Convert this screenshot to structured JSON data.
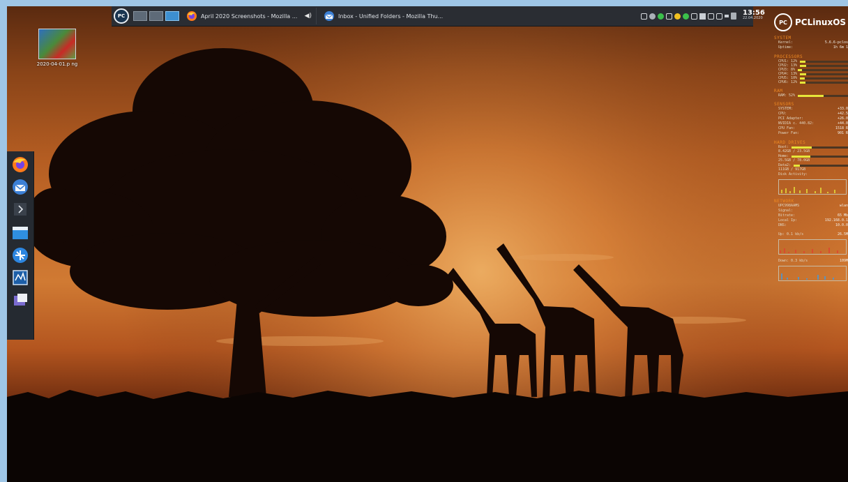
{
  "panel": {
    "menu_logo": "PC",
    "virtual_desktops": [
      {
        "active": false
      },
      {
        "active": false
      },
      {
        "active": true
      }
    ],
    "tasks": [
      {
        "title": "April 2020 Screenshots - Mozilla ...",
        "icon": "firefox-icon",
        "sound": "◀)"
      },
      {
        "title": "Inbox - Unified Folders - Mozilla Thu...",
        "icon": "thunderbird-icon"
      }
    ],
    "clock": {
      "time": "13:56",
      "date": "22.04.2020"
    }
  },
  "desktop_icon": {
    "label": "2020-04-01.p ng"
  },
  "dock": {
    "items": [
      "firefox-icon",
      "thunderbird-icon",
      "expand-arrow-icon",
      "files-icon",
      "network-icon",
      "system-monitor-icon",
      "messenger-icon"
    ]
  },
  "conky": {
    "brand": "PCLinuxOS",
    "system": {
      "header": "SYSTEM",
      "kernel_label": "Kernel:",
      "kernel": "5.6.6-pclos",
      "uptime_label": "Uptime:",
      "uptime": "1h 6m 1"
    },
    "processors": {
      "header": "PROCESSORS",
      "cpus": [
        {
          "label": "CPU1: 12%",
          "value": 12
        },
        {
          "label": "CPU2: 13%",
          "value": 13
        },
        {
          "label": "CPU3: 8%",
          "value": 8
        },
        {
          "label": "CPU4: 13%",
          "value": 13
        },
        {
          "label": "CPU5: 10%",
          "value": 10
        },
        {
          "label": "CPU6: 12%",
          "value": 12
        }
      ]
    },
    "ram": {
      "header": "RAM",
      "label": "RAM:  52%",
      "value": 52
    },
    "sensors": {
      "header": "SENSORS",
      "rows": [
        {
          "label": "SYSTEM:",
          "value": "+33.0"
        },
        {
          "label": "CPU:",
          "value": "+42.5"
        },
        {
          "label": "PCI Adapter:",
          "value": "+26.0"
        },
        {
          "label": "NVIDIA c. 440.82:",
          "value": "+44.0"
        },
        {
          "label": "CPU Fan:",
          "value": "1518 R"
        },
        {
          "label": "Power Fan:",
          "value": "901 R"
        }
      ]
    },
    "drives": {
      "header": "HARD DRIVES",
      "disks": [
        {
          "name": "Root:",
          "usage": "8.42GB / 23.5GB",
          "value": 36
        },
        {
          "name": "Home:",
          "usage": "25.5GB / 78.0GB",
          "value": 33
        },
        {
          "name": "Data2:",
          "usage": "111GB / 917GB",
          "value": 12
        }
      ],
      "activity_label": "Disk Activity:"
    },
    "network": {
      "header": "NETWORK",
      "rows": [
        {
          "label": "UPC998AAMS",
          "value": "wlan"
        },
        {
          "label": "Signal:",
          "value": ""
        },
        {
          "label": "Bitrate:",
          "value": "65 Mb"
        },
        {
          "label": "Local Ip:",
          "value": "192.168.0.1"
        },
        {
          "label": "DNS:",
          "value": "10.0.0"
        }
      ],
      "up_label": "Up: 0.1 kb/s",
      "up_total": "26.5M",
      "down_label": "Down: 0.3 kb/s",
      "down_total": "109M"
    }
  }
}
